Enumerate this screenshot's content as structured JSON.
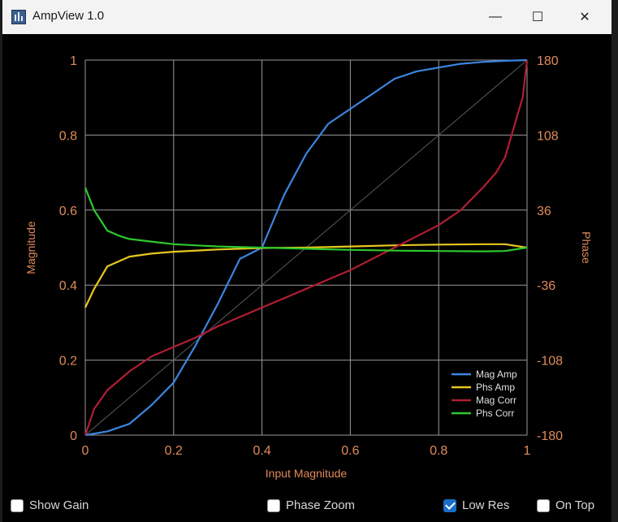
{
  "window": {
    "title": "AmpView 1.0",
    "controls": {
      "minimize": "—",
      "maximize": "☐",
      "close": "✕"
    }
  },
  "checkboxes": [
    {
      "label": "Show Gain",
      "checked": false
    },
    {
      "label": "Phase Zoom",
      "checked": false
    },
    {
      "label": "Low Res",
      "checked": true
    },
    {
      "label": "On Top",
      "checked": false
    }
  ],
  "colors": {
    "background": "#000000",
    "grid": "#9a9a9a",
    "axis_text": "#e08a5a",
    "legend_text": "#e0e0e0"
  },
  "chart_data": {
    "type": "line",
    "xlabel": "Input Magnitude",
    "ylabel": "Magnitude",
    "y2label": "Phase",
    "xlim": [
      0,
      1
    ],
    "ylim": [
      0,
      1
    ],
    "y2lim": [
      -180,
      180
    ],
    "x_ticks": [
      "0",
      "0.2",
      "0.4",
      "0.6",
      "0.8",
      "1"
    ],
    "y_ticks": [
      "0",
      "0.2",
      "0.4",
      "0.6",
      "0.8",
      "1"
    ],
    "y2_ticks": [
      "-180",
      "-108",
      "-36",
      "36",
      "108",
      "180"
    ],
    "grid": true,
    "legend_position": "bottom-right",
    "reference_line": {
      "x": [
        0,
        1
      ],
      "y": [
        0,
        1
      ],
      "color": "#5a5a5a"
    },
    "series": [
      {
        "name": "Mag Amp",
        "color": "#3a86e0",
        "x": [
          0,
          0.05,
          0.1,
          0.15,
          0.2,
          0.25,
          0.3,
          0.35,
          0.4,
          0.45,
          0.5,
          0.55,
          0.6,
          0.65,
          0.7,
          0.75,
          0.8,
          0.85,
          0.9,
          0.95,
          1.0
        ],
        "y": [
          0,
          0.01,
          0.03,
          0.08,
          0.14,
          0.24,
          0.35,
          0.47,
          0.5,
          0.64,
          0.75,
          0.83,
          0.87,
          0.91,
          0.95,
          0.97,
          0.98,
          0.99,
          0.995,
          0.998,
          1.0
        ]
      },
      {
        "name": "Phs Amp",
        "color": "#e8c81e",
        "x": [
          0,
          0.02,
          0.05,
          0.1,
          0.15,
          0.2,
          0.3,
          0.4,
          0.5,
          0.6,
          0.7,
          0.8,
          0.9,
          0.95,
          1.0
        ],
        "y": [
          0.34,
          0.39,
          0.45,
          0.476,
          0.484,
          0.489,
          0.495,
          0.499,
          0.5,
          0.503,
          0.506,
          0.508,
          0.509,
          0.509,
          0.5
        ]
      },
      {
        "name": "Mag Corr",
        "color": "#b01e32",
        "x": [
          0,
          0.02,
          0.05,
          0.1,
          0.15,
          0.2,
          0.25,
          0.3,
          0.4,
          0.5,
          0.6,
          0.7,
          0.8,
          0.85,
          0.9,
          0.93,
          0.95,
          0.97,
          0.99,
          1.0
        ],
        "y": [
          0,
          0.07,
          0.12,
          0.17,
          0.21,
          0.235,
          0.26,
          0.29,
          0.34,
          0.39,
          0.44,
          0.5,
          0.56,
          0.6,
          0.66,
          0.7,
          0.74,
          0.82,
          0.9,
          1.0
        ]
      },
      {
        "name": "Phs Corr",
        "color": "#2ec82e",
        "x": [
          0,
          0.02,
          0.05,
          0.08,
          0.1,
          0.15,
          0.2,
          0.3,
          0.4,
          0.5,
          0.6,
          0.7,
          0.8,
          0.9,
          0.95,
          1.0
        ],
        "y": [
          0.66,
          0.6,
          0.545,
          0.53,
          0.523,
          0.516,
          0.509,
          0.503,
          0.5,
          0.497,
          0.494,
          0.492,
          0.491,
          0.49,
          0.491,
          0.5
        ]
      }
    ]
  }
}
